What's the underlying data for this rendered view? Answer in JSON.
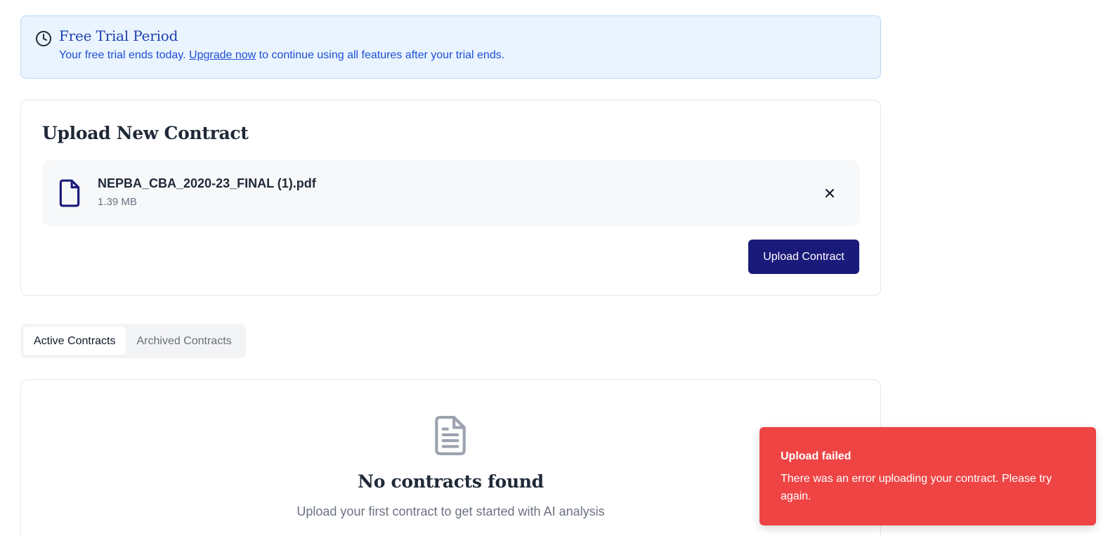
{
  "trial_banner": {
    "title": "Free Trial Period",
    "text_before": "Your free trial ends today.",
    "link_label": "Upgrade now",
    "text_after": "to continue using all features after your trial ends."
  },
  "upload": {
    "title": "Upload New Contract",
    "file_name": "NEPBA_CBA_2020-23_FINAL (1).pdf",
    "file_size": "1.39 MB",
    "button_label": "Upload Contract"
  },
  "tabs": [
    {
      "label": "Active Contracts",
      "active": true
    },
    {
      "label": "Archived Contracts",
      "active": false
    }
  ],
  "empty_state": {
    "title": "No contracts found",
    "subtitle": "Upload your first contract to get started with AI analysis"
  },
  "toast": {
    "title": "Upload failed",
    "message": "There was an error uploading your contract. Please try again."
  },
  "colors": {
    "primary": "#1a1a7a",
    "banner_bg": "#eaf4fe",
    "banner_text": "#1d4ed8",
    "error": "#ef4444"
  },
  "icons": {
    "banner": "clock-icon",
    "file": "file-icon",
    "remove": "close-icon",
    "empty": "document-text-icon"
  }
}
